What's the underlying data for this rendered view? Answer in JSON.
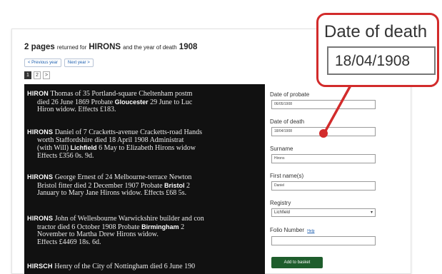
{
  "results": {
    "count": "2 pages",
    "returned_for": "returned for",
    "surname": "HIRONS",
    "and_year": "and the year of death",
    "year": "1908"
  },
  "nav": {
    "previous": "< Previous year",
    "next": "Next year >"
  },
  "pagination": [
    "1",
    "2",
    ">"
  ],
  "calendar": [
    {
      "surname": "HIRON",
      "line1": "Thomas of 35 Portland-square Cheltenham postm",
      "line2a": "died 26 June 1869 Probate",
      "place": "Gloucester",
      "line2b": "29 June to Luc",
      "line3": "Hiron widow.   Effects £183."
    },
    {
      "surname": "HIRONS",
      "line1": "Daniel of 7 Cracketts-avenue Cracketts-road Hands",
      "line2": "worth Staffordshire died 18 April 1908 Administrat",
      "line3a": "(with Will)",
      "place": "Lichfield",
      "line3b": "6 May to Elizabeth Hirons widow",
      "line4": "Effects £356 0s. 9d."
    },
    {
      "surname": "HIRONS",
      "line1": "George Ernest of 24 Melbourne-terrace Newton",
      "line2a": "Bristol fitter died 2 December 1907 Probate",
      "place": "Bristol",
      "line2b": "2",
      "line3": "January to Mary Jane Hirons widow.   Effects £68 5s."
    },
    {
      "surname": "HIRONS",
      "line1": "John of Wellesbourne Warwickshire builder and con",
      "line2a": "tractor died 6 October 1908 Probate",
      "place": "Birmingham",
      "line2b": "2",
      "line3": "November to Martha Drew Hirons widow.",
      "line4": "Effects £4469 18s. 6d."
    },
    {
      "surname": "HIRSCH",
      "line1": "Henry of the City of Nottingham died 6 June 190"
    }
  ],
  "form": {
    "probate_label": "Date of probate",
    "probate_value": "06/05/1908",
    "death_label": "Date of death",
    "death_value": "18/04/1908",
    "surname_label": "Surname",
    "surname_value": "Hirons",
    "firstname_label": "First name(s)",
    "firstname_value": "Daniel",
    "registry_label": "Registry",
    "registry_value": "Lichfield",
    "folio_label": "Folio Number",
    "folio_help": "Help",
    "folio_value": "",
    "add_button": "Add to basket"
  },
  "callout": {
    "title": "Date of death",
    "value": "18/04/1908"
  },
  "colors": {
    "callout_border": "#d22b2b",
    "add_button": "#1e5d2c",
    "link": "#1d5fb0",
    "scan_background": "#111111"
  }
}
